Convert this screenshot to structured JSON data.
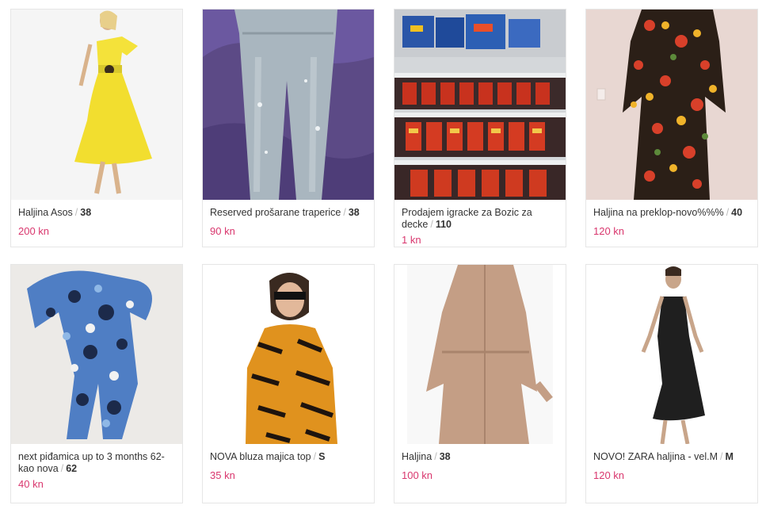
{
  "listings": [
    {
      "title": "Haljina Asos",
      "size": "38",
      "price": "200 kn"
    },
    {
      "title": "Reserved prošarane traperice",
      "size": "38",
      "price": "90 kn"
    },
    {
      "title": "Prodajem igracke za Bozic za decke",
      "size": "110",
      "price": "1 kn"
    },
    {
      "title": "Haljina na preklop-novo%%%",
      "size": "40",
      "price": "120 kn"
    },
    {
      "title": "next piđamica up to 3 months 62-kao nova",
      "size": "62",
      "price": "40 kn"
    },
    {
      "title": "NOVA bluza majica top",
      "size": "S",
      "price": "35 kn"
    },
    {
      "title": "Haljina",
      "size": "38",
      "price": "100 kn"
    },
    {
      "title": "NOVO! ZARA haljina - vel.M",
      "size": "M",
      "price": "120 kn"
    }
  ],
  "separator": "/",
  "colors": {
    "price": "#d9376e",
    "border": "#e6e6e6"
  }
}
